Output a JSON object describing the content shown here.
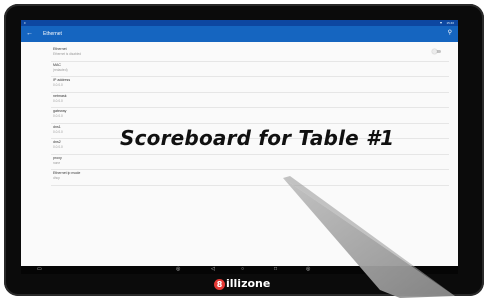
{
  "status_bar": {
    "time": "15:46",
    "wifi_icon": "wifi-icon",
    "carrier": "≡"
  },
  "app_bar": {
    "title": "Ethernet",
    "back_icon": "arrow-back-icon",
    "search_icon": "search-icon"
  },
  "settings": [
    {
      "label": "Ethernet",
      "value": "Ethernet is disabled",
      "toggle": true,
      "toggle_on": false
    },
    {
      "label": "MAC",
      "value": "(redacted)"
    },
    {
      "label": "IP address",
      "value": "0.0.0.0"
    },
    {
      "label": "netmask",
      "value": "0.0.0.0"
    },
    {
      "label": "gateway",
      "value": "0.0.0.0"
    },
    {
      "label": "dns1",
      "value": "0.0.0.0"
    },
    {
      "label": "dns2",
      "value": "0.0.0.0"
    },
    {
      "label": "proxy",
      "value": "none"
    },
    {
      "label": "Ethernet ip mode",
      "value": "dhcp"
    }
  ],
  "nav_bar": {
    "items": [
      "▭",
      "◎",
      "◁",
      "○",
      "□",
      "◎"
    ]
  },
  "overlay": {
    "caption": "Scoreboard for Table #1"
  },
  "brand": {
    "logo_text": "illizone",
    "logo_ball_glyph": "8"
  },
  "colors": {
    "appbar": "#1565c0",
    "statusbar": "#0d47a1",
    "bezel": "#0b0b0b",
    "logo_ball": "#e53935"
  }
}
